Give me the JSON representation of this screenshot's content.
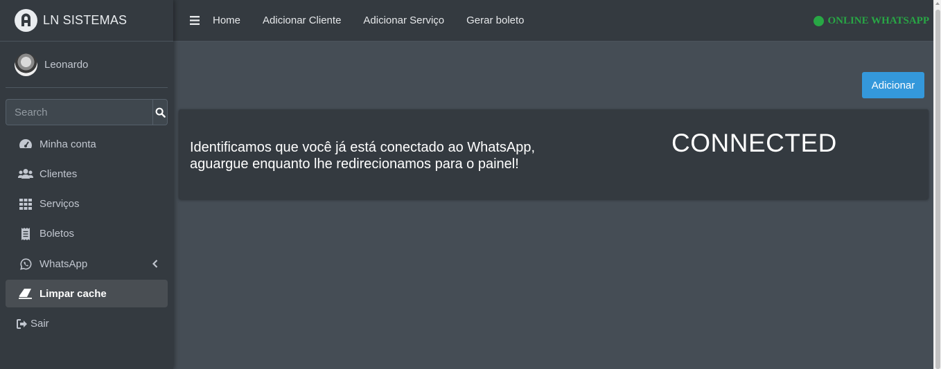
{
  "brand": {
    "name": "LN SISTEMAS",
    "logo_letter": "A"
  },
  "user": {
    "name": "Leonardo"
  },
  "search": {
    "placeholder": "Search"
  },
  "sidebar": {
    "items": [
      {
        "label": "Minha conta",
        "icon": "tachometer-icon"
      },
      {
        "label": "Clientes",
        "icon": "users-icon"
      },
      {
        "label": "Serviços",
        "icon": "grid-icon"
      },
      {
        "label": "Boletos",
        "icon": "receipt-icon"
      },
      {
        "label": "WhatsApp",
        "icon": "whatsapp-icon"
      },
      {
        "label": "Limpar cache",
        "icon": "eraser-icon",
        "active": true
      },
      {
        "label": "Sair",
        "icon": "sign-out-icon"
      }
    ]
  },
  "topnav": {
    "links": [
      "Home",
      "Adicionar Cliente",
      "Adicionar Serviço",
      "Gerar boleto"
    ],
    "status": "ONLINE WHATSAPP",
    "status_color": "#28a745"
  },
  "main": {
    "add_button": "Adicionar",
    "message_line1": "Identificamos que você já está conectado ao WhatsApp,",
    "message_line2": "aguargue enquanto lhe redirecionamos para o painel!",
    "status_text": "CONNECTED"
  },
  "colors": {
    "sidebar_bg": "#343a40",
    "content_bg": "#454d55",
    "accent": "#3498db"
  }
}
